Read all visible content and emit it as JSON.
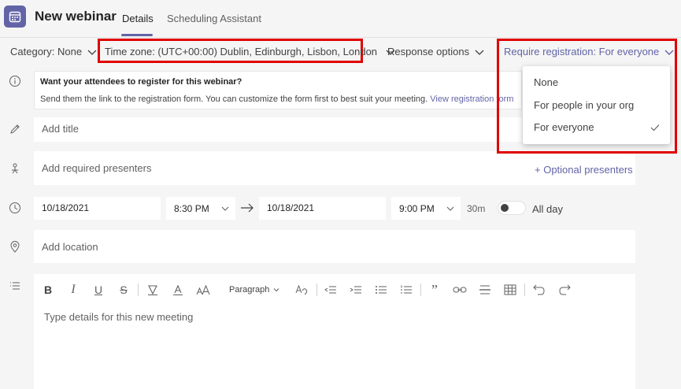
{
  "header": {
    "title": "New webinar",
    "tabs": [
      {
        "label": "Details",
        "active": true
      },
      {
        "label": "Scheduling Assistant",
        "active": false
      }
    ]
  },
  "options_bar": {
    "category": "Category: None",
    "time_zone": "Time zone: (UTC+00:00) Dublin, Edinburgh, Lisbon, London",
    "response_options": "Response options",
    "registration": "Require registration: For everyone"
  },
  "registration_dropdown": {
    "items": [
      "None",
      "For people in your org",
      "For everyone"
    ],
    "selected": "For everyone"
  },
  "banner": {
    "title": "Want your attendees to register for this webinar?",
    "text": "Send them the link to the registration form. You can customize the form first to best suit your meeting.",
    "link": "View registration form"
  },
  "form": {
    "title_placeholder": "Add title",
    "presenters_placeholder": "Add required presenters",
    "optional_presenters": "+ Optional presenters",
    "start_date": "10/18/2021",
    "start_time": "8:30 PM",
    "end_date": "10/18/2021",
    "end_time": "9:00 PM",
    "duration": "30m",
    "all_day": "All day",
    "location_placeholder": "Add location",
    "details_placeholder": "Type details for this new meeting"
  },
  "toolbar": {
    "paragraph": "Paragraph"
  },
  "colors": {
    "accent": "#6264a7",
    "highlight": "#e00000"
  }
}
